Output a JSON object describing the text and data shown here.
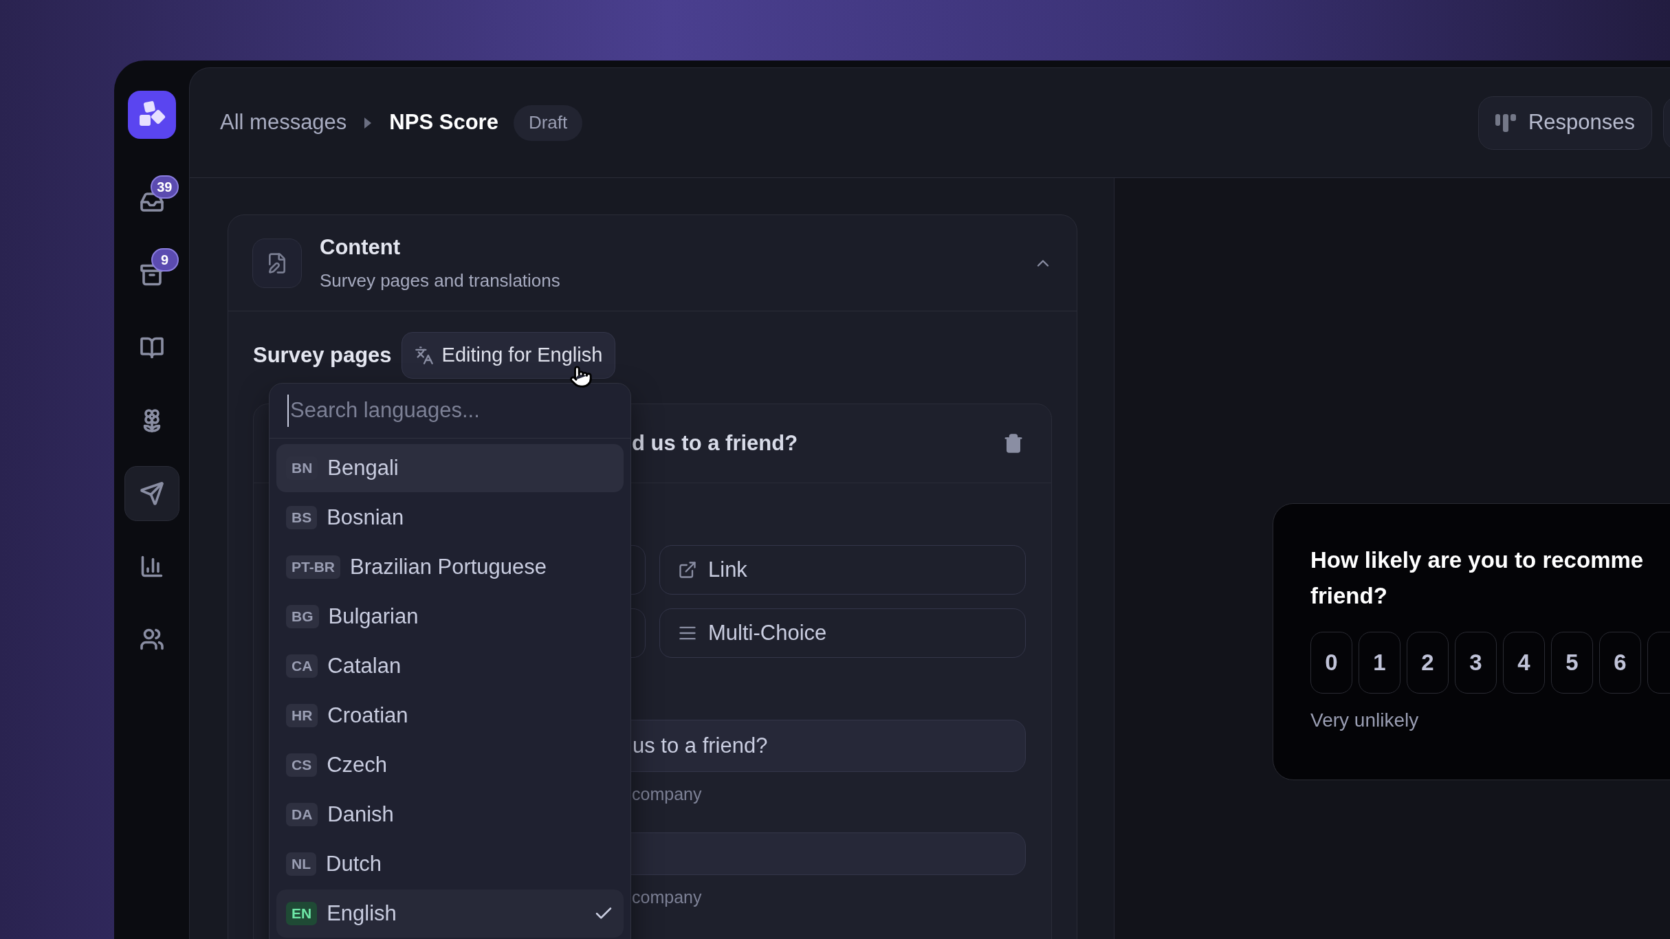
{
  "sidebar": {
    "items": [
      {
        "kind": "inbox",
        "badge": "39",
        "selected": false
      },
      {
        "kind": "archive",
        "badge": "9",
        "selected": false
      },
      {
        "kind": "book",
        "selected": false
      },
      {
        "kind": "flower",
        "selected": false
      },
      {
        "kind": "send",
        "selected": true
      },
      {
        "kind": "chart",
        "selected": false
      },
      {
        "kind": "users",
        "selected": false
      }
    ]
  },
  "header": {
    "breadcrumb_parent": "All messages",
    "breadcrumb_current": "NPS Score",
    "status": "Draft",
    "actions": [
      {
        "label": "Responses"
      }
    ]
  },
  "content_section": {
    "title": "Content",
    "subtitle": "Survey pages and translations",
    "expanded": true
  },
  "survey_pages": {
    "label": "Survey pages",
    "language_button": "Editing for English"
  },
  "page_card": {
    "question": "d us to a friend?",
    "options": [
      {
        "label": "Link",
        "kind": "link"
      },
      {
        "label": "Multi-Choice",
        "kind": "list"
      }
    ],
    "fields": [
      {
        "value": "us to a friend?",
        "hint": "company"
      },
      {
        "hint": "company"
      }
    ]
  },
  "language_menu": {
    "placeholder": "Search languages...",
    "items": [
      {
        "code": "BN",
        "name": "Bengali",
        "highlighted": true,
        "selected": false
      },
      {
        "code": "BS",
        "name": "Bosnian",
        "highlighted": false,
        "selected": false
      },
      {
        "code": "PT-BR",
        "name": "Brazilian Portuguese",
        "highlighted": false,
        "selected": false
      },
      {
        "code": "BG",
        "name": "Bulgarian",
        "highlighted": false,
        "selected": false
      },
      {
        "code": "CA",
        "name": "Catalan",
        "highlighted": false,
        "selected": false
      },
      {
        "code": "HR",
        "name": "Croatian",
        "highlighted": false,
        "selected": false
      },
      {
        "code": "CS",
        "name": "Czech",
        "highlighted": false,
        "selected": false
      },
      {
        "code": "DA",
        "name": "Danish",
        "highlighted": false,
        "selected": false
      },
      {
        "code": "NL",
        "name": "Dutch",
        "highlighted": false,
        "selected": false
      },
      {
        "code": "EN",
        "name": "English",
        "highlighted": false,
        "selected": true
      }
    ]
  },
  "preview": {
    "question_lines": [
      "How likely are you to recomme",
      "friend?"
    ],
    "scale": [
      "0",
      "1",
      "2",
      "3",
      "4",
      "5",
      "6"
    ],
    "low_label": "Very unlikely"
  }
}
